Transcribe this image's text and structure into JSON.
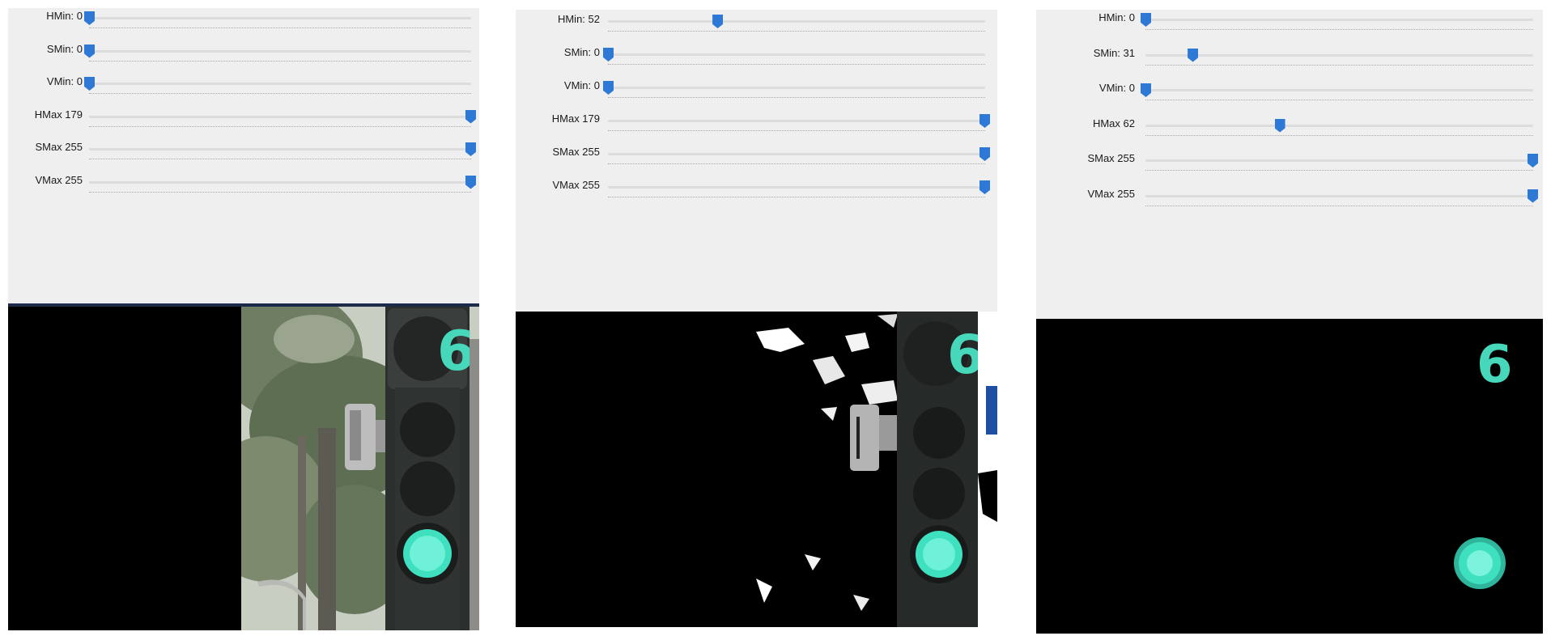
{
  "panels": [
    {
      "id": "panel-1",
      "trackbars": [
        {
          "label": "HMin: 0",
          "value": 0,
          "max": 179
        },
        {
          "label": "SMin: 0",
          "value": 0,
          "max": 255
        },
        {
          "label": "VMin: 0",
          "value": 0,
          "max": 255
        },
        {
          "label": "HMax 179",
          "value": 179,
          "max": 179
        },
        {
          "label": "SMax 255",
          "value": 255,
          "max": 255
        },
        {
          "label": "VMax 255",
          "value": 255,
          "max": 255
        }
      ]
    },
    {
      "id": "panel-2",
      "trackbars": [
        {
          "label": "HMin: 52",
          "value": 52,
          "max": 179
        },
        {
          "label": "SMin: 0",
          "value": 0,
          "max": 255
        },
        {
          "label": "VMin: 0",
          "value": 0,
          "max": 255
        },
        {
          "label": "HMax 179",
          "value": 179,
          "max": 179
        },
        {
          "label": "SMax 255",
          "value": 255,
          "max": 255
        },
        {
          "label": "VMax 255",
          "value": 255,
          "max": 255
        }
      ]
    },
    {
      "id": "panel-3",
      "trackbars": [
        {
          "label": "HMin: 0",
          "value": 0,
          "max": 179
        },
        {
          "label": "SMin: 31",
          "value": 31,
          "max": 255
        },
        {
          "label": "VMin: 0",
          "value": 0,
          "max": 255
        },
        {
          "label": "HMax 62",
          "value": 62,
          "max": 179
        },
        {
          "label": "SMax 255",
          "value": 255,
          "max": 255
        },
        {
          "label": "VMax 255",
          "value": 255,
          "max": 255
        }
      ]
    }
  ],
  "countdown_digit": "6",
  "colors": {
    "slider_handle": "#2f79d6",
    "signal_green": "#3fe0c0",
    "toolbar_bg": "#efefef"
  }
}
